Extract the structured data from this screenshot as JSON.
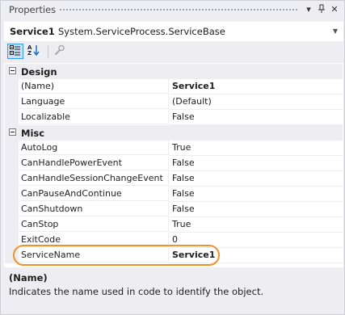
{
  "window": {
    "title": "Properties",
    "controls": {
      "dropdown_glyph": "▾",
      "pin_glyph": "ꟷ",
      "close_glyph": "✕"
    }
  },
  "object_selector": {
    "name": "Service1",
    "type": "System.ServiceProcess.ServiceBase"
  },
  "toolbar": {
    "buttons": [
      {
        "icon": "categorized-icon",
        "active": true
      },
      {
        "icon": "alphabetical-icon",
        "active": false
      },
      {
        "icon": "property-pages-icon",
        "active": false
      }
    ]
  },
  "grid": {
    "categories": [
      {
        "label": "Design",
        "properties": [
          {
            "name": "(Name)",
            "value": "Service1",
            "bold": true
          },
          {
            "name": "Language",
            "value": "(Default)",
            "bold": false
          },
          {
            "name": "Localizable",
            "value": "False",
            "bold": false
          }
        ]
      },
      {
        "label": "Misc",
        "properties": [
          {
            "name": "AutoLog",
            "value": "True",
            "bold": false
          },
          {
            "name": "CanHandlePowerEvent",
            "value": "False",
            "bold": false
          },
          {
            "name": "CanHandleSessionChangeEvent",
            "value": "False",
            "bold": false
          },
          {
            "name": "CanPauseAndContinue",
            "value": "False",
            "bold": false
          },
          {
            "name": "CanShutdown",
            "value": "False",
            "bold": false
          },
          {
            "name": "CanStop",
            "value": "True",
            "bold": false
          },
          {
            "name": "ExitCode",
            "value": "0",
            "bold": false
          },
          {
            "name": "ServiceName",
            "value": "Service1",
            "bold": true
          }
        ]
      }
    ],
    "highlight_color": "#f0932b"
  },
  "description": {
    "title": "(Name)",
    "text": "Indicates the name used in code to identify the object."
  }
}
